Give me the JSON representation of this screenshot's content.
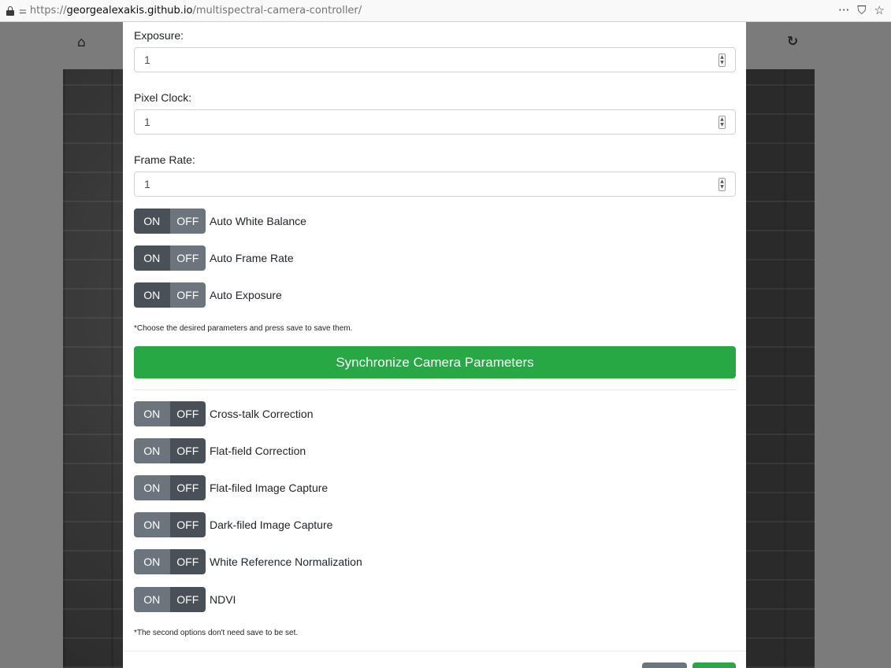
{
  "browser": {
    "url_prefix": "https://",
    "url_host": "georgealexakis.github.io",
    "url_path": "/multispectral-camera-controller/",
    "menu_icon": "ellipsis-icon",
    "pocket_icon": "pocket-icon",
    "bookmark_icon": "star-icon"
  },
  "params": {
    "exposure_label": "Exposure:",
    "exposure_value": "1",
    "pixel_clock_label": "Pixel Clock:",
    "pixel_clock_value": "1",
    "frame_rate_label": "Frame Rate:",
    "frame_rate_value": "1"
  },
  "toggles_top": [
    {
      "on": "ON",
      "off": "OFF",
      "label": "Auto White Balance",
      "state": "on"
    },
    {
      "on": "ON",
      "off": "OFF",
      "label": "Auto Frame Rate",
      "state": "on"
    },
    {
      "on": "ON",
      "off": "OFF",
      "label": "Auto Exposure",
      "state": "on"
    }
  ],
  "note_top": "*Choose the desired parameters and press save to save them.",
  "sync_button": "Synchronize Camera Parameters",
  "toggles_bottom": [
    {
      "on": "ON",
      "off": "OFF",
      "label": "Cross-talk Correction",
      "state": "off"
    },
    {
      "on": "ON",
      "off": "OFF",
      "label": "Flat-field Correction",
      "state": "off"
    },
    {
      "on": "ON",
      "off": "OFF",
      "label": "Flat-filed Image Capture",
      "state": "off"
    },
    {
      "on": "ON",
      "off": "OFF",
      "label": "Dark-filed Image Capture",
      "state": "off"
    },
    {
      "on": "ON",
      "off": "OFF",
      "label": "White Reference Normalization",
      "state": "off"
    },
    {
      "on": "ON",
      "off": "OFF",
      "label": "NDVI",
      "state": "off"
    }
  ],
  "note_bottom": "*The second options don't need save to be set.",
  "colors": {
    "success": "#28a745",
    "secondary": "#6c757d",
    "dark_active": "#495057"
  }
}
